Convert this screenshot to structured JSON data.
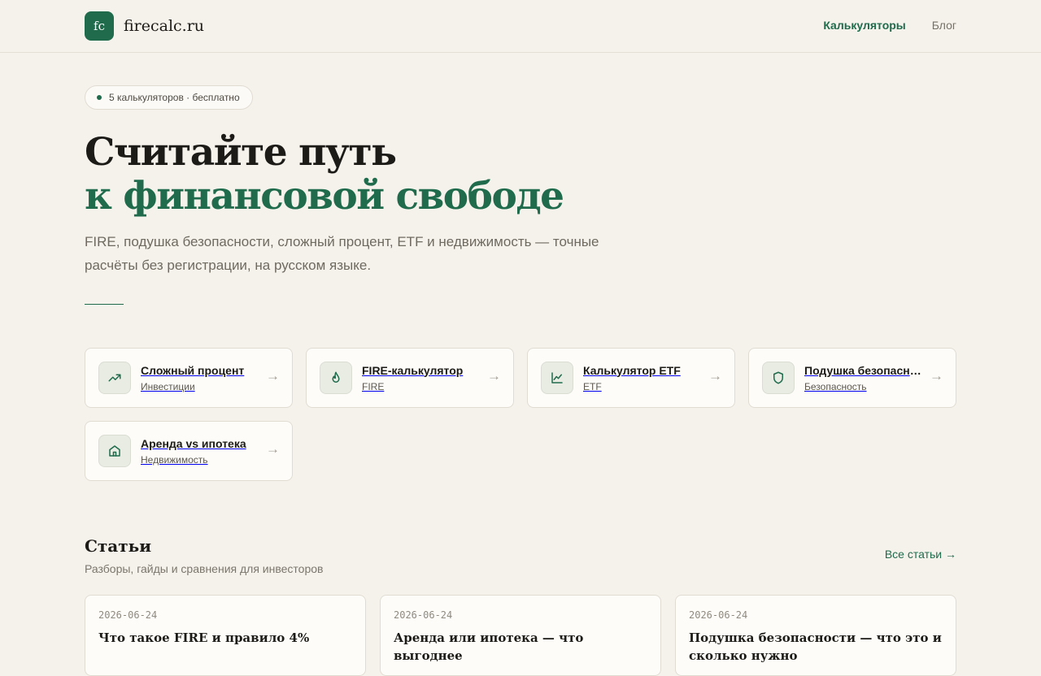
{
  "header": {
    "logo_mark": "fc",
    "logo_text": "firecalc.ru",
    "nav": [
      {
        "label": "Калькуляторы",
        "active": true
      },
      {
        "label": "Блог",
        "active": false
      }
    ]
  },
  "hero": {
    "badge": "5 калькуляторов · бесплатно",
    "title_line1": "Считайте путь",
    "title_line2": "к финансовой свободе",
    "subtitle": "FIRE, подушка безопасности, сложный процент, ETF и недвижимость — точные расчёты без регистрации, на русском языке."
  },
  "calculators": [
    {
      "title": "Сложный процент",
      "category": "Инвестиции",
      "icon": "trending-up-icon"
    },
    {
      "title": "FIRE-калькулятор",
      "category": "FIRE",
      "icon": "flame-icon"
    },
    {
      "title": "Калькулятор ETF",
      "category": "ETF",
      "icon": "line-chart-icon"
    },
    {
      "title": "Подушка безопасности",
      "category": "Безопасность",
      "icon": "shield-icon"
    },
    {
      "title": "Аренда vs ипотека",
      "category": "Недвижимость",
      "icon": "home-icon"
    }
  ],
  "arrow": "→",
  "articles": {
    "title": "Статьи",
    "subtitle": "Разборы, гайды и сравнения для инвесторов",
    "all_link": "Все статьи →",
    "items": [
      {
        "date": "2026-06-24",
        "title": "Что такое FIRE и правило 4%"
      },
      {
        "date": "2026-06-24",
        "title": "Аренда или ипотека — что выгоднее"
      },
      {
        "date": "2026-06-24",
        "title": "Подушка безопасности — что это и сколько нужно"
      }
    ]
  },
  "colors": {
    "accent": "#1f6b4c",
    "background": "#f5f2ec",
    "card": "#fdfcf9"
  }
}
